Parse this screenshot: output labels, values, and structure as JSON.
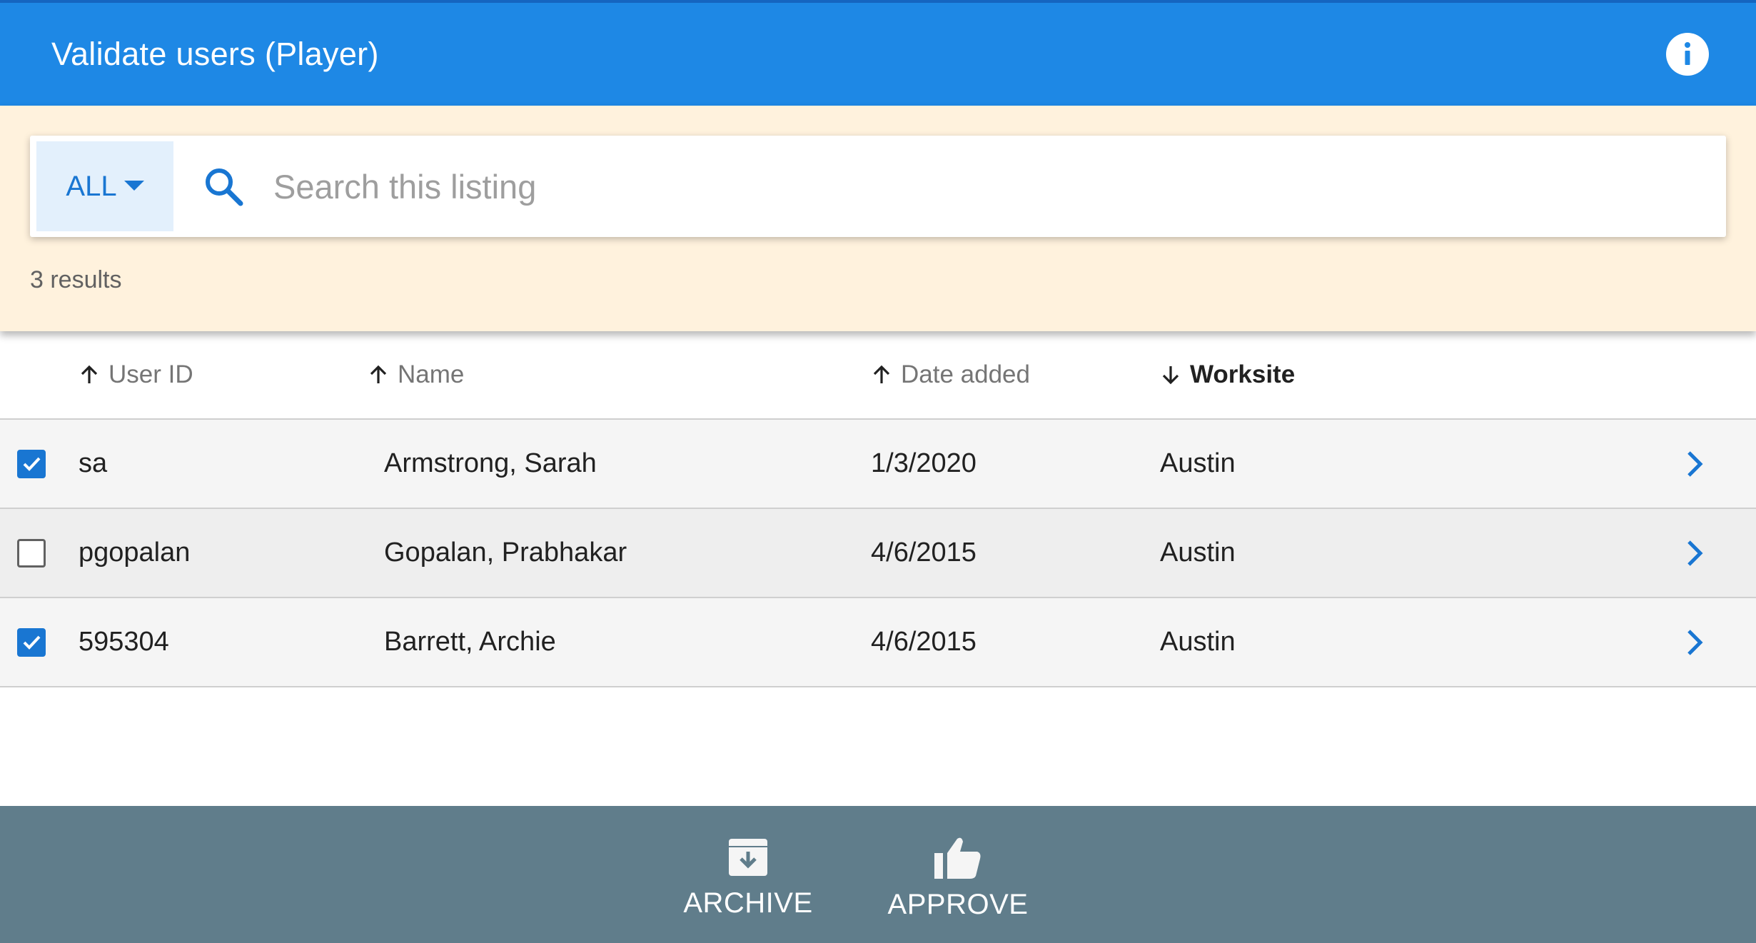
{
  "header": {
    "title": "Validate users (Player)",
    "info_icon": "info-icon"
  },
  "search": {
    "filter_label": "ALL",
    "placeholder": "Search this listing",
    "value": "",
    "results": "3 results"
  },
  "table": {
    "columns": [
      {
        "label": "User ID",
        "sort": "ascending",
        "active": false
      },
      {
        "label": "Name",
        "sort": "ascending",
        "active": false
      },
      {
        "label": "Date added",
        "sort": "ascending",
        "active": false
      },
      {
        "label": "Worksite",
        "sort": "descending",
        "active": true
      }
    ],
    "rows": [
      {
        "checked": true,
        "user_id": "sa",
        "name": "Armstrong, Sarah",
        "date_added": "1/3/2020",
        "worksite": "Austin"
      },
      {
        "checked": false,
        "user_id": "pgopalan",
        "name": "Gopalan, Prabhakar",
        "date_added": "4/6/2015",
        "worksite": "Austin"
      },
      {
        "checked": true,
        "user_id": "595304",
        "name": "Barrett, Archie",
        "date_added": "4/6/2015",
        "worksite": "Austin"
      }
    ]
  },
  "footer": {
    "archive_label": "ARCHIVE",
    "approve_label": "APPROVE"
  },
  "colors": {
    "header_bg": "#1e88e5",
    "search_band_bg": "#fff2dd",
    "accent": "#1976d2",
    "footer_bg": "#607d8b"
  }
}
